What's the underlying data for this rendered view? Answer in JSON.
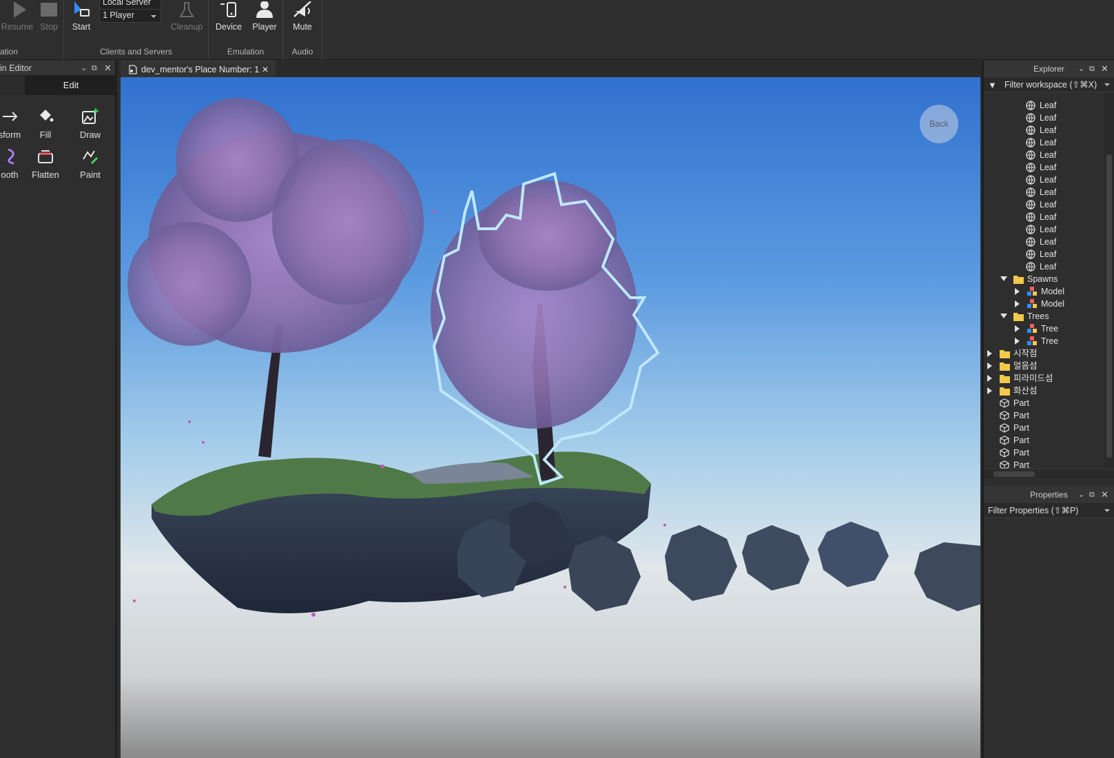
{
  "ribbon": {
    "resume_label": "Resume",
    "stop_label": "Stop",
    "start_label": "Start",
    "server_select_value": "Local Server",
    "player_select_value": "1 Player",
    "cleanup_label": "Cleanup",
    "device_label": "Device",
    "player_label": "Player",
    "mute_label": "Mute",
    "groups": {
      "simulation": "ation",
      "clients_servers": "Clients and Servers",
      "emulation": "Emulation",
      "audio": "Audio"
    }
  },
  "terrain_editor": {
    "title": "in Editor",
    "tab_edit": "Edit",
    "tools": {
      "transform": "sform",
      "fill": "Fill",
      "draw": "Draw",
      "smooth": "ooth",
      "flatten": "Flatten",
      "paint": "Paint"
    }
  },
  "document_tab": {
    "label": "dev_mentor's Place Number: 1"
  },
  "viewport": {
    "back_label": "Back"
  },
  "explorer": {
    "title": "Explorer",
    "filter_placeholder": "Filter workspace (⇧⌘X)",
    "nodes": [
      {
        "label": "Leaf"
      },
      {
        "label": "Leaf"
      },
      {
        "label": "Leaf"
      },
      {
        "label": "Leaf"
      },
      {
        "label": "Leaf"
      },
      {
        "label": "Leaf"
      },
      {
        "label": "Leaf"
      },
      {
        "label": "Leaf"
      },
      {
        "label": "Leaf"
      },
      {
        "label": "Leaf"
      },
      {
        "label": "Leaf"
      },
      {
        "label": "Leaf"
      },
      {
        "label": "Leaf"
      },
      {
        "label": "Leaf"
      },
      {
        "label": "Spawns"
      },
      {
        "label": "Model"
      },
      {
        "label": "Model"
      },
      {
        "label": "Trees"
      },
      {
        "label": "Tree"
      },
      {
        "label": "Tree"
      },
      {
        "label": "시작점"
      },
      {
        "label": "얼음섬"
      },
      {
        "label": "피라미드섬"
      },
      {
        "label": "화산섬"
      },
      {
        "label": "Part"
      },
      {
        "label": "Part"
      },
      {
        "label": "Part"
      },
      {
        "label": "Part"
      },
      {
        "label": "Part"
      },
      {
        "label": "Part"
      }
    ]
  },
  "properties": {
    "title": "Properties",
    "filter_placeholder": "Filter Properties (⇧⌘P)"
  },
  "colors": {
    "accent": "#2f8fff",
    "selection_outline": "#bfe8ff",
    "folder": "#f2c94c"
  }
}
